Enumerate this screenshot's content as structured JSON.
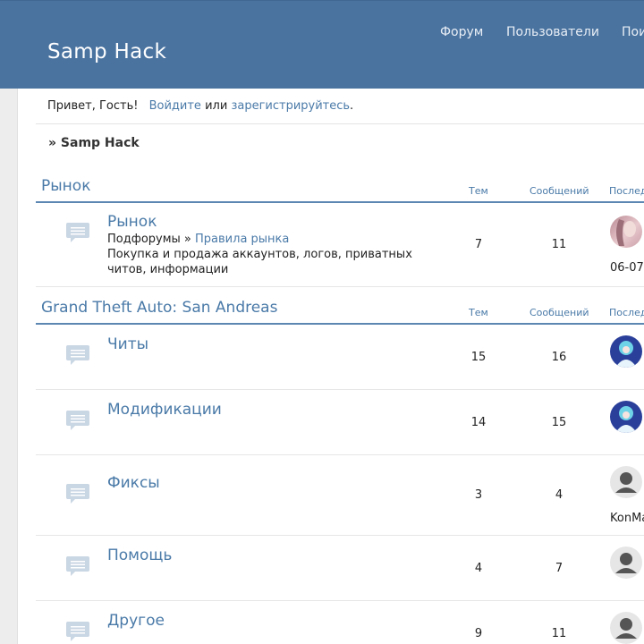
{
  "header": {
    "site_title": "Samp Hack",
    "nav": [
      "Форум",
      "Пользователи",
      "Пои"
    ]
  },
  "greeting": {
    "prefix": "Привет, Гость!",
    "login": "Войдите",
    "or": "или",
    "register": "зарегистрируйтесь",
    "suffix": "."
  },
  "breadcrumb": "» Samp Hack",
  "columns": {
    "topics": "Тем",
    "posts": "Сообщений",
    "last": "Послед"
  },
  "categories": [
    {
      "title": "Рынок",
      "forums": [
        {
          "name": "Рынок",
          "subforums_label": "Подфорумы »",
          "subforum": "Правила рынка",
          "description": "Покупка и продажа аккаунтов, логов, приватных читов, информации",
          "topics": "7",
          "posts": "11",
          "last_text": "06-07"
        }
      ]
    },
    {
      "title": "Grand Theft Auto: San Andreas",
      "forums": [
        {
          "name": "Читы",
          "topics": "15",
          "posts": "16"
        },
        {
          "name": "Модификации",
          "topics": "14",
          "posts": "15"
        },
        {
          "name": "Фиксы",
          "topics": "3",
          "posts": "4",
          "last_text": "KonMa"
        },
        {
          "name": "Помощь",
          "topics": "4",
          "posts": "7"
        },
        {
          "name": "Другое",
          "topics": "9",
          "posts": "11"
        }
      ]
    }
  ],
  "colors": {
    "header_bg": "#4a73a0",
    "link": "#4a7aa8",
    "category_line": "#5d87b3"
  }
}
